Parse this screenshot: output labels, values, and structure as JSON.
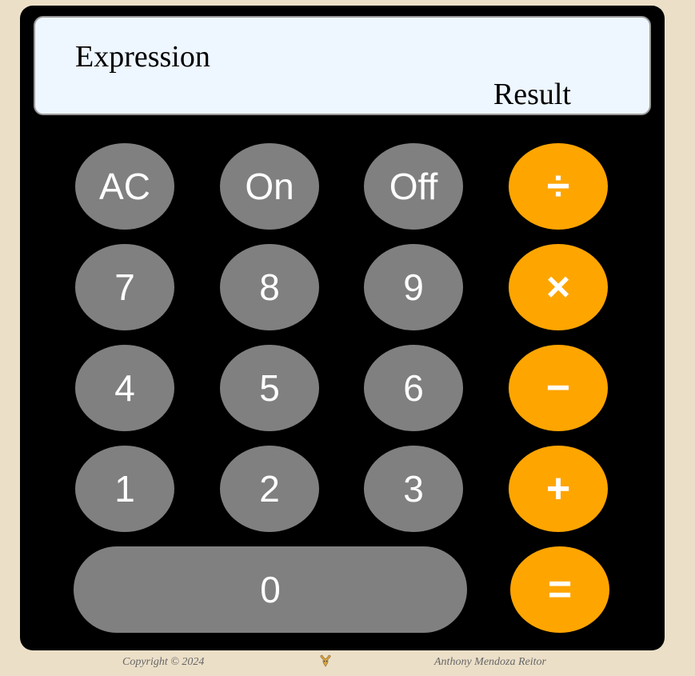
{
  "display": {
    "expression": "Expression",
    "result": "Result"
  },
  "keypad": {
    "ac": "AC",
    "on": "On",
    "off": "Off",
    "divide": "÷",
    "seven": "7",
    "eight": "8",
    "nine": "9",
    "multiply": "×",
    "four": "4",
    "five": "5",
    "six": "6",
    "subtract": "−",
    "one": "1",
    "two": "2",
    "three": "3",
    "add": "+",
    "zero": "0",
    "equals": "="
  },
  "footer": {
    "copyright": "Copyright © 2024",
    "author": "Anthony Mendoza Reitor",
    "logo_icon": "ram-head-logo-icon"
  },
  "colors": {
    "page_background": "#ecdfc8",
    "calculator_body": "#000000",
    "display_background": "#eef6ff",
    "number_key": "#808080",
    "operator_key": "#ffa500",
    "key_text": "#ffffff"
  }
}
